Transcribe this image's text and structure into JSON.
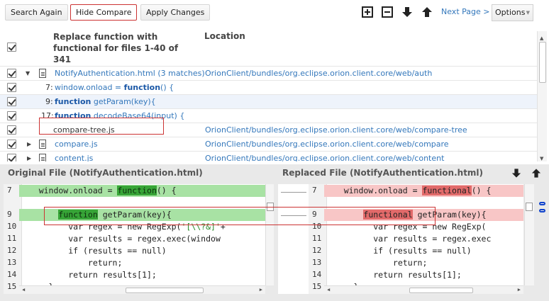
{
  "toolbar": {
    "search_again": "Search Again",
    "hide_compare": "Hide Compare",
    "apply_changes": "Apply Changes",
    "next_page": "Next Page >",
    "options": "Options"
  },
  "results": {
    "header_title": "Replace function with functional for files 1-40 of 341",
    "header_location": "Location",
    "rows": [
      {
        "label": "NotifyAuthentication.html (3 matches)",
        "location": "OrionClient/bundles/org.eclipse.orion.client.core/web/auth"
      },
      {
        "line": "7:",
        "pre": "window.onload = ",
        "kw": "function",
        "post": "() {"
      },
      {
        "line": "9:",
        "kw": "function",
        "post": " getParam(key){"
      },
      {
        "line": "17:",
        "kw": "function",
        "post": " decodeBase64(input) {"
      },
      {
        "label": "compare-tree.js",
        "location": "OrionClient/bundles/org.eclipse.orion.client.core/web/compare-tree"
      },
      {
        "label": "compare.js",
        "location": "OrionClient/bundles/org.eclipse.orion.client.core/web/compare"
      },
      {
        "label": "content.js",
        "location": "OrionClient/bundles/org.eclipse.orion.client.core/web/content"
      }
    ]
  },
  "compare": {
    "original_title": "Original File (NotifyAuthentication.html)",
    "replaced_title": "Replaced File (NotifyAuthentication.html)",
    "line_numbers": [
      "7",
      "",
      "9",
      "10",
      "11",
      "12",
      "13",
      "14",
      "15"
    ],
    "original": {
      "l7_pre": "    window.onload = ",
      "l7_kw": "function",
      "l7_post": "() {",
      "l9_kw": "function",
      "l9_post": " getParam(key){",
      "l10_pre": "          var regex = new RegExp(",
      "l10_str": "'[\\\\?&]'",
      "l10_post": "+",
      "l11": "          var results = regex.exec(window",
      "l12": "          if (results == null)",
      "l13": "              return;",
      "l14": "          return results[1];",
      "l15": "      }"
    },
    "replaced": {
      "l7_pre": "    window.onload = ",
      "l7_kw": "functional",
      "l7_post": "() {",
      "l9_kw": "functional",
      "l9_post": " getParam(key){",
      "l10": "          var regex = new RegExp(",
      "l11": "          var results = regex.exec",
      "l12": "          if (results == null)",
      "l13": "              return;",
      "l14": "          return results[1];",
      "l15": "      }"
    }
  },
  "icons": [
    "expand-all-icon",
    "collapse-all-icon",
    "next-diff-icon",
    "previous-diff-icon",
    "file-icon",
    "checkbox-icon"
  ]
}
